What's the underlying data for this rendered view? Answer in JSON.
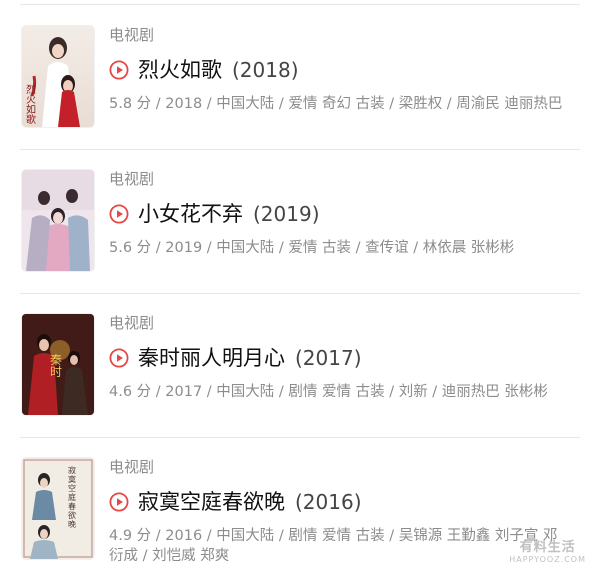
{
  "items": [
    {
      "category": "电视剧",
      "title": "烈火如歌",
      "year": "(2018)",
      "meta": "5.8 分 / 2018 / 中国大陆 / 爱情 奇幻 古装 / 梁胜权 / 周渝民 迪丽热巴",
      "poster_text": "烈火如歌"
    },
    {
      "category": "电视剧",
      "title": "小女花不弃",
      "year": "(2019)",
      "meta": "5.6 分 / 2019 / 中国大陆 / 爱情 古装 / 查传谊 / 林依晨 张彬彬",
      "poster_text": ""
    },
    {
      "category": "电视剧",
      "title": "秦时丽人明月心",
      "year": "(2017)",
      "meta": "4.6 分 / 2017 / 中国大陆 / 剧情 爱情 古装 / 刘新 / 迪丽热巴 张彬彬",
      "poster_text": "秦时"
    },
    {
      "category": "电视剧",
      "title": "寂寞空庭春欲晚",
      "year": "(2016)",
      "meta": "4.9 分 / 2016 / 中国大陆 / 剧情 爱情 古装 / 吴锦源 王勤鑫 刘子宣 邓衍成 / 刘恺威 郑爽",
      "poster_text": "寂寞空庭春欲晚"
    }
  ],
  "watermark": {
    "main": "有料生活",
    "sub": "HAPPYOOZ.COM"
  },
  "colors": {
    "play": "#e64646",
    "category": "#8c8c8c",
    "divider": "#e6e6e6"
  }
}
